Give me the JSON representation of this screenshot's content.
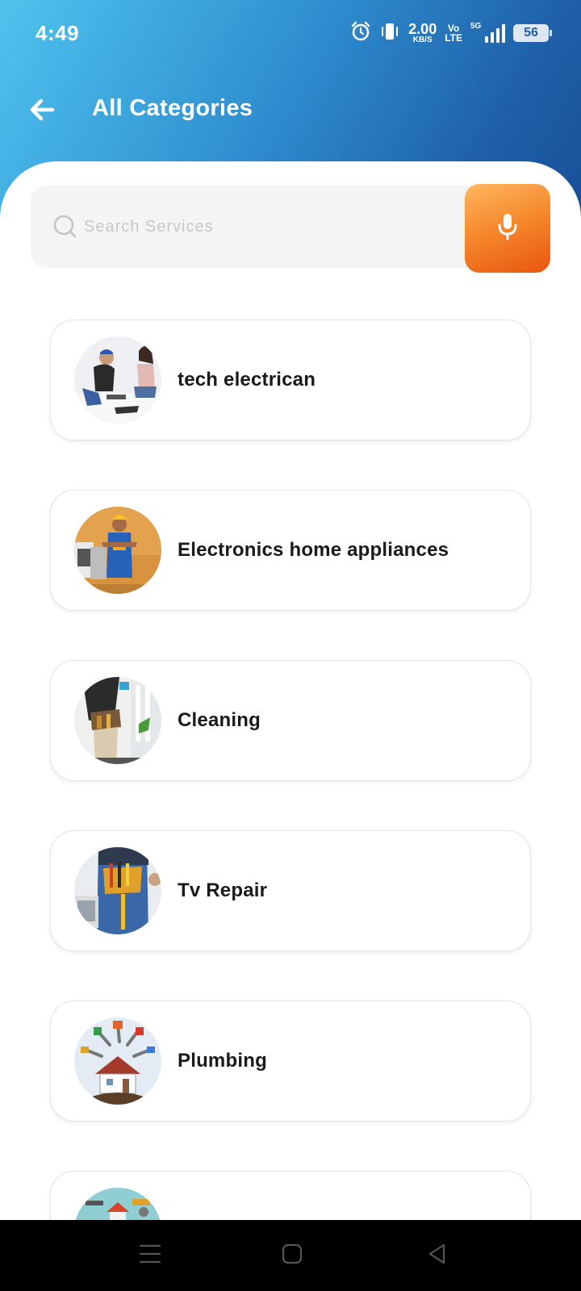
{
  "status_bar": {
    "time": "4:49",
    "speed_value": "2.00",
    "speed_unit": "KB/S",
    "volte_top": "Vo",
    "volte_bottom": "LTE",
    "network": "5G",
    "battery": "56",
    "icons": [
      "alarm-icon",
      "vibrate-icon",
      "signal-icon",
      "battery-icon"
    ]
  },
  "header": {
    "title": "All Categories",
    "back_icon": "arrow-left-icon"
  },
  "search": {
    "placeholder": "Search Services",
    "value": "",
    "mic_icon": "microphone-icon"
  },
  "categories": [
    {
      "label": "tech electrican",
      "image": "electrician-and-customer-photo"
    },
    {
      "label": "Electronics home appliances",
      "image": "technician-in-kitchen-photo"
    },
    {
      "label": "Cleaning",
      "image": "worker-with-tool-belt-photo"
    },
    {
      "label": "Tv Repair",
      "image": "tool-belt-closeup-photo"
    },
    {
      "label": "Plumbing",
      "image": "house-and-tools-illustration"
    },
    {
      "label": "",
      "image": "tools-illustration"
    }
  ],
  "colors": {
    "header_gradient_start": "#4fc3ee",
    "header_gradient_end": "#174e95",
    "mic_gradient_start": "#ffb760",
    "mic_gradient_end": "#e9560e",
    "nav_bar": "#000000"
  },
  "nav_bar": {
    "icons": [
      "menu-icon",
      "home-icon",
      "back-triangle-icon"
    ]
  }
}
